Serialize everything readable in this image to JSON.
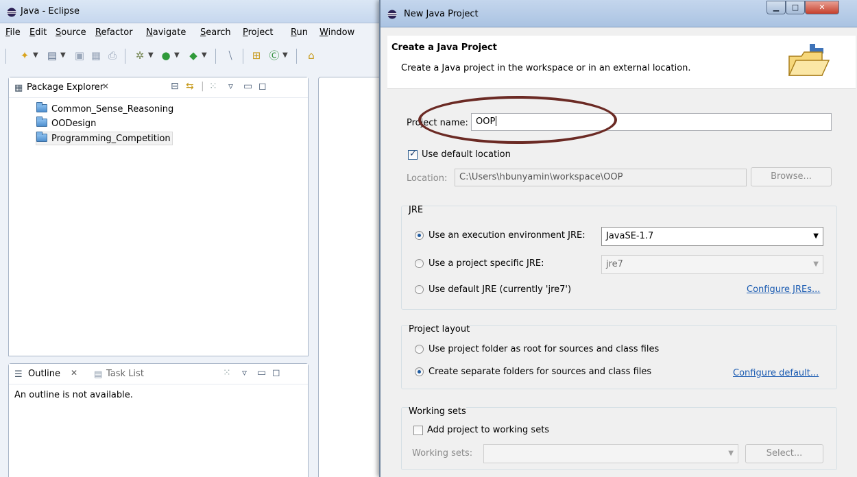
{
  "eclipse": {
    "window_title": "Java - Eclipse",
    "menu": [
      "File",
      "Edit",
      "Source",
      "Refactor",
      "Navigate",
      "Search",
      "Project",
      "Run",
      "Window"
    ],
    "package_explorer": {
      "tab_label": "Package Explorer",
      "close_glyph": "✕",
      "projects": [
        "Common_Sense_Reasoning",
        "OODesign",
        "Programming_Competition"
      ],
      "selected_project": "Programming_Competition"
    },
    "outline": {
      "tab_label": "Outline",
      "close_glyph": "✕",
      "task_tab_label": "Task List",
      "message": "An outline is not available."
    }
  },
  "dialog": {
    "window_title": "New Java Project",
    "header_title": "Create a Java Project",
    "header_desc": "Create a Java project in the workspace or in an external location.",
    "project_name_label": "Project name:",
    "project_name_value": "OOP",
    "use_default_location_label": "Use default location",
    "use_default_location_checked": true,
    "location_label": "Location:",
    "location_value": "C:\\Users\\hbunyamin\\workspace\\OOP",
    "browse_label": "Browse...",
    "jre": {
      "group_label": "JRE",
      "option_env_label": "Use an execution environment JRE:",
      "option_env_value": "JavaSE-1.7",
      "option_specific_label": "Use a project specific JRE:",
      "option_specific_value": "jre7",
      "option_default_label": "Use default JRE (currently 'jre7')",
      "configure_link": "Configure JREs...",
      "selected": "execution-environment"
    },
    "layout": {
      "group_label": "Project layout",
      "option_root_label": "Use project folder as root for sources and class files",
      "option_separate_label": "Create separate folders for sources and class files",
      "configure_link": "Configure default...",
      "selected": "separate-folders"
    },
    "working_sets": {
      "group_label": "Working sets",
      "add_label": "Add project to working sets",
      "add_checked": false,
      "sets_label": "Working sets:",
      "select_label": "Select..."
    }
  },
  "colors": {
    "annotation_ellipse": "#6b2a24",
    "link": "#1c5cb2",
    "close_button": "#c6402c"
  }
}
